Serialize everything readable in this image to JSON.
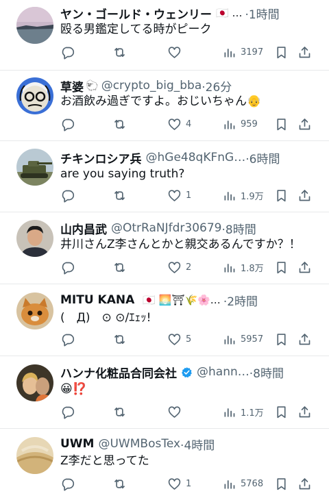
{
  "posts": [
    {
      "name": "ヤン・ゴールド・ウェンリー",
      "emoji": "🇯🇵 …",
      "handle": "",
      "time": "·1時間",
      "text": "殴る男鑑定してる時がピーク",
      "likes": "",
      "views": "3197"
    },
    {
      "name": "草婆",
      "emoji": "🐑",
      "handle": "@crypto_big_bba",
      "time": "·26分",
      "text": "お酒飲み過ぎですよ。おじいちゃん👴",
      "likes": "4",
      "views": "959"
    },
    {
      "name": "チキンロシア兵",
      "emoji": "",
      "handle": "@hGe48qKFnG…",
      "time": "·6時間",
      "text": "are you saying truth?",
      "likes": "1",
      "views": "1.9万"
    },
    {
      "name": "山内昌武",
      "emoji": "",
      "handle": "@OtrRaNJfdr30679",
      "time": "·8時間",
      "text": "井川さんZ李さんとかと親交あるんですか？！",
      "likes": "2",
      "views": "1.8万"
    },
    {
      "name": "MITU KANA",
      "emoji": "🇯🇵 🌅⛩🌾🌸…",
      "handle": "",
      "time": "·2時間",
      "text": "(　Д)　⊙ ⊙/ｴｪｯ!",
      "likes": "5",
      "views": "5957"
    },
    {
      "name": "ハンナ化粧品合同会社",
      "emoji": "",
      "handle": "@hann…",
      "time": "·8時間",
      "text": "😀⁉️",
      "likes": "",
      "views": "1.1万"
    },
    {
      "name": "UWM",
      "emoji": "",
      "handle": "@UWMBosTex",
      "time": "·4時間",
      "text": "Z李だと思ってた",
      "likes": "1",
      "views": "5768"
    }
  ],
  "icons": {
    "reply": "reply-icon",
    "repost": "repost-icon",
    "like": "heart-icon",
    "views": "views-icon",
    "bookmark": "bookmark-icon",
    "share": "share-icon"
  },
  "colors": {
    "text": "#0f1419",
    "secondary": "#536471",
    "verified": "#1d9bf0",
    "divider": "#e7e9ea"
  }
}
